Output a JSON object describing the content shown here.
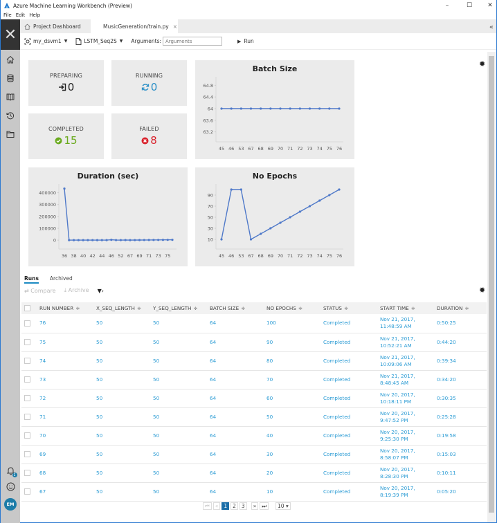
{
  "window": {
    "title": "Azure Machine Learning Workbench (Preview)",
    "menu": [
      "File",
      "Edit",
      "Help"
    ],
    "controls": {
      "minimize": "–",
      "maximize": "☐",
      "close": "✕"
    }
  },
  "sidebar": {
    "close_icon": "✕",
    "items": [
      "home-icon",
      "database-icon",
      "notebook-icon",
      "history-icon",
      "folder-icon"
    ],
    "bottom": {
      "notification_count": "1",
      "avatar_initials": "EM"
    }
  },
  "tabs": [
    {
      "label": "Project Dashboard",
      "icon": "home-icon",
      "active": false
    },
    {
      "label": "MusicGeneration/train.py",
      "close": "×",
      "active": true
    }
  ],
  "toolbar": {
    "compute_target": "my_dsvm1",
    "run_config": "LSTM_Seq2S",
    "arguments_label": "Arguments:",
    "arguments_placeholder": "Arguments",
    "arguments_value": "",
    "run_label": "Run",
    "collapse_icon": "«"
  },
  "stats": {
    "preparing": {
      "label": "PREPARING",
      "value": "0",
      "color": "#222222"
    },
    "running": {
      "label": "RUNNING",
      "value": "0",
      "color": "#2a8fc7"
    },
    "completed": {
      "label": "COMPLETED",
      "value": "15",
      "color": "#6aaa1e"
    },
    "failed": {
      "label": "FAILED",
      "value": "8",
      "color": "#d9232d"
    }
  },
  "chart_data": [
    {
      "type": "line",
      "title": "Batch Size",
      "x": [
        "45",
        "46",
        "53",
        "67",
        "68",
        "69",
        "70",
        "71",
        "72",
        "73",
        "74",
        "75",
        "76"
      ],
      "values": [
        64,
        64,
        64,
        64,
        64,
        64,
        64,
        64,
        64,
        64,
        64,
        64,
        64
      ],
      "yticks": [
        "64.8",
        "64.4",
        "64",
        "63.6",
        "63.2"
      ],
      "ylim": [
        63.0,
        65.0
      ],
      "xlabel": "",
      "ylabel": "",
      "grid": false,
      "color": "#4f79c9"
    },
    {
      "type": "line",
      "title": "Duration (sec)",
      "x": [
        "36",
        "37",
        "38",
        "39",
        "40",
        "41",
        "42",
        "43",
        "44",
        "45",
        "46",
        "47",
        "52",
        "53",
        "67",
        "68",
        "69",
        "70",
        "71",
        "72",
        "73",
        "74",
        "75",
        "76"
      ],
      "xtick_labels": [
        "36",
        "38",
        "40",
        "42",
        "44",
        "46",
        "52",
        "67",
        "69",
        "71",
        "73",
        "75"
      ],
      "values": [
        435000,
        300,
        320,
        280,
        310,
        290,
        330,
        300,
        350,
        400,
        3025,
        600,
        500,
        700,
        320,
        611,
        903,
        1198,
        1528,
        1835,
        2060,
        2374,
        2660,
        3025
      ],
      "yticks": [
        "400000",
        "300000",
        "200000",
        "100000",
        "0"
      ],
      "ylim": [
        -40000,
        450000
      ],
      "xlabel": "",
      "ylabel": "",
      "grid": false,
      "color": "#4f79c9"
    },
    {
      "type": "line",
      "title": "No Epochs",
      "x": [
        "45",
        "46",
        "53",
        "67",
        "68",
        "69",
        "70",
        "71",
        "72",
        "73",
        "74",
        "75",
        "76"
      ],
      "values": [
        10,
        100,
        100,
        10,
        20,
        30,
        40,
        50,
        60,
        70,
        80,
        90,
        100
      ],
      "yticks": [
        "90",
        "70",
        "50",
        "30",
        "10"
      ],
      "ylim": [
        0,
        105
      ],
      "xlabel": "",
      "ylabel": "",
      "grid": false,
      "color": "#4f79c9"
    }
  ],
  "runs": {
    "tabs": [
      "Runs",
      "Archived"
    ],
    "actions": {
      "compare": "Compare",
      "archive": "Archive",
      "filter": "▾›"
    },
    "columns": [
      "RUN NUMBER",
      "X_SEQ_LENGTH",
      "Y_SEQ_LENGTH",
      "BATCH SIZE",
      "NO EPOCHS",
      "STATUS",
      "START TIME",
      "DURATION"
    ],
    "rows": [
      {
        "run": "76",
        "x": "50",
        "y": "50",
        "batch": "64",
        "epochs": "100",
        "status": "Completed",
        "date": "Nov 21, 2017,",
        "time": "11:48:59 AM",
        "duration": "0:50:25"
      },
      {
        "run": "75",
        "x": "50",
        "y": "50",
        "batch": "64",
        "epochs": "90",
        "status": "Completed",
        "date": "Nov 21, 2017,",
        "time": "10:52:21 AM",
        "duration": "0:44:20"
      },
      {
        "run": "74",
        "x": "50",
        "y": "50",
        "batch": "64",
        "epochs": "80",
        "status": "Completed",
        "date": "Nov 21, 2017,",
        "time": "10:09:06 AM",
        "duration": "0:39:34"
      },
      {
        "run": "73",
        "x": "50",
        "y": "50",
        "batch": "64",
        "epochs": "70",
        "status": "Completed",
        "date": "Nov 21, 2017,",
        "time": "8:48:45 AM",
        "duration": "0:34:20"
      },
      {
        "run": "72",
        "x": "50",
        "y": "50",
        "batch": "64",
        "epochs": "60",
        "status": "Completed",
        "date": "Nov 20, 2017,",
        "time": "10:18:11 PM",
        "duration": "0:30:35"
      },
      {
        "run": "71",
        "x": "50",
        "y": "50",
        "batch": "64",
        "epochs": "50",
        "status": "Completed",
        "date": "Nov 20, 2017,",
        "time": "9:47:52 PM",
        "duration": "0:25:28"
      },
      {
        "run": "70",
        "x": "50",
        "y": "50",
        "batch": "64",
        "epochs": "40",
        "status": "Completed",
        "date": "Nov 20, 2017,",
        "time": "9:25:30 PM",
        "duration": "0:19:58"
      },
      {
        "run": "69",
        "x": "50",
        "y": "50",
        "batch": "64",
        "epochs": "30",
        "status": "Completed",
        "date": "Nov 20, 2017,",
        "time": "8:58:07 PM",
        "duration": "0:15:03"
      },
      {
        "run": "68",
        "x": "50",
        "y": "50",
        "batch": "64",
        "epochs": "20",
        "status": "Completed",
        "date": "Nov 20, 2017,",
        "time": "8:28:30 PM",
        "duration": "0:10:11"
      },
      {
        "run": "67",
        "x": "50",
        "y": "50",
        "batch": "64",
        "epochs": "10",
        "status": "Completed",
        "date": "Nov 20, 2017,",
        "time": "8:19:39 PM",
        "duration": "0:05:20"
      }
    ],
    "pagination": {
      "first": "⏮",
      "prev": "«",
      "pages": [
        "1",
        "2",
        "3"
      ],
      "current": "1",
      "next": "»",
      "last": "⏭",
      "page_size": "10 ▾"
    }
  }
}
